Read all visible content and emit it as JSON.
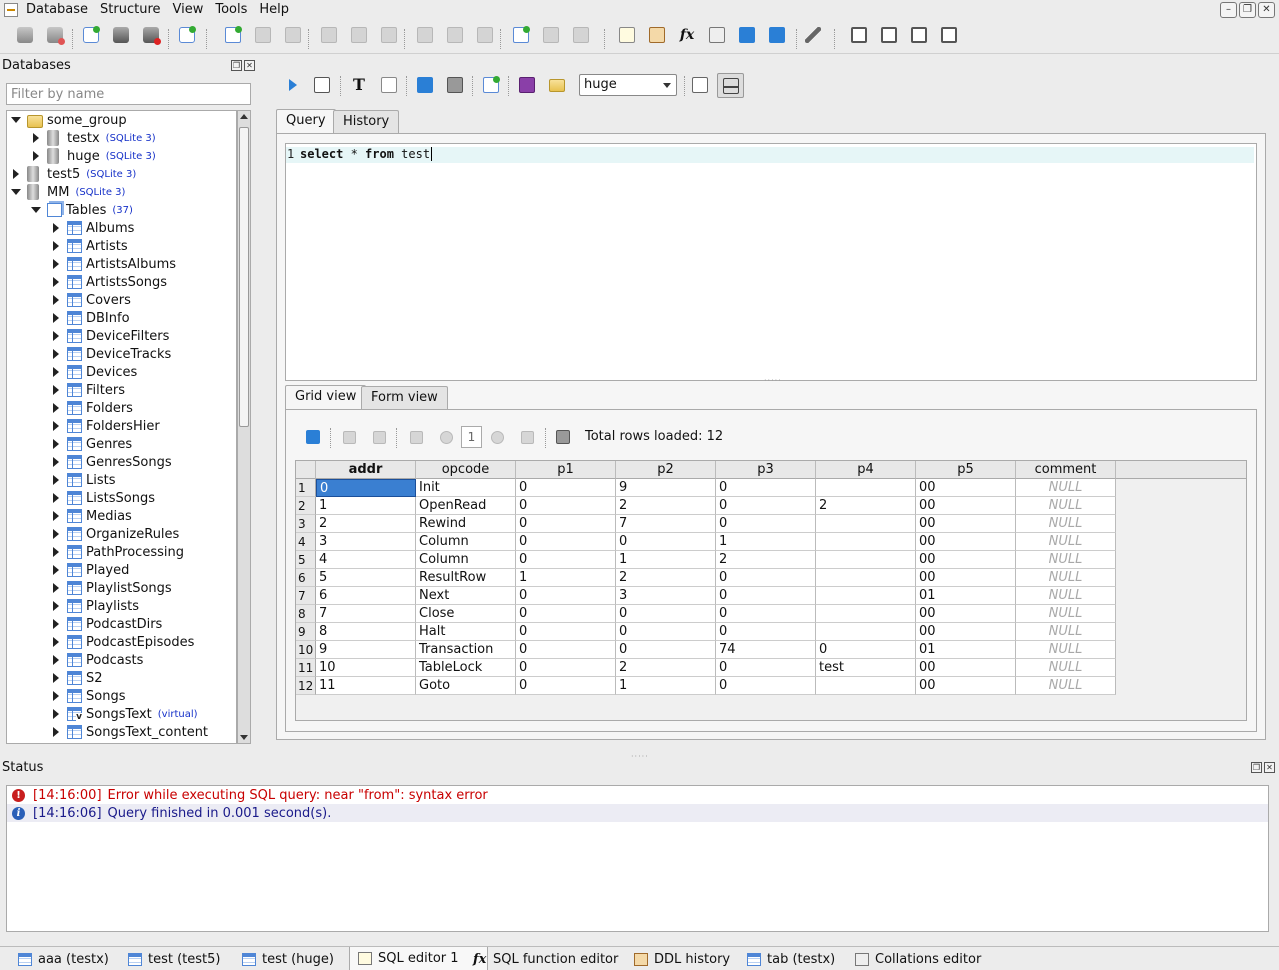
{
  "menu": [
    "Database",
    "Structure",
    "View",
    "Tools",
    "Help"
  ],
  "databases_panel": {
    "title": "Databases",
    "filter_placeholder": "Filter by name",
    "group": "some_group",
    "group_dbs": [
      {
        "name": "testx",
        "type": "(SQLite 3)"
      },
      {
        "name": "huge",
        "type": "(SQLite 3)"
      }
    ],
    "dbs": [
      {
        "name": "test5",
        "type": "(SQLite 3)"
      },
      {
        "name": "MM",
        "type": "(SQLite 3)"
      }
    ],
    "tables_label": "Tables",
    "tables_count": "(37)",
    "tables": [
      "Albums",
      "Artists",
      "ArtistsAlbums",
      "ArtistsSongs",
      "Covers",
      "DBInfo",
      "DeviceFilters",
      "DeviceTracks",
      "Devices",
      "Filters",
      "Folders",
      "FoldersHier",
      "Genres",
      "GenresSongs",
      "Lists",
      "ListsSongs",
      "Medias",
      "OrganizeRules",
      "PathProcessing",
      "Played",
      "PlaylistSongs",
      "Playlists",
      "PodcastDirs",
      "PodcastEpisodes",
      "Podcasts",
      "S2",
      "Songs",
      "SongsText",
      "SongsText_content"
    ],
    "virtual_label": "(virtual)"
  },
  "editor": {
    "db_select": "huge",
    "tabs": [
      "Query",
      "History"
    ],
    "line_number": "1",
    "sql": {
      "kw1": "select",
      "star": " * ",
      "kw2": "from",
      "rest": " test"
    },
    "result_tabs": [
      "Grid view",
      "Form view"
    ],
    "page": "1",
    "rows_loaded": "Total rows loaded: 12"
  },
  "grid": {
    "columns": [
      "addr",
      "opcode",
      "p1",
      "p2",
      "p3",
      "p4",
      "p5",
      "comment"
    ],
    "rows": [
      [
        "0",
        "Init",
        "0",
        "9",
        "0",
        "",
        "00",
        "NULL"
      ],
      [
        "1",
        "OpenRead",
        "0",
        "2",
        "0",
        "2",
        "00",
        "NULL"
      ],
      [
        "2",
        "Rewind",
        "0",
        "7",
        "0",
        "",
        "00",
        "NULL"
      ],
      [
        "3",
        "Column",
        "0",
        "0",
        "1",
        "",
        "00",
        "NULL"
      ],
      [
        "4",
        "Column",
        "0",
        "1",
        "2",
        "",
        "00",
        "NULL"
      ],
      [
        "5",
        "ResultRow",
        "1",
        "2",
        "0",
        "",
        "00",
        "NULL"
      ],
      [
        "6",
        "Next",
        "0",
        "3",
        "0",
        "",
        "01",
        "NULL"
      ],
      [
        "7",
        "Close",
        "0",
        "0",
        "0",
        "",
        "00",
        "NULL"
      ],
      [
        "8",
        "Halt",
        "0",
        "0",
        "0",
        "",
        "00",
        "NULL"
      ],
      [
        "9",
        "Transaction",
        "0",
        "0",
        "74",
        "0",
        "01",
        "NULL"
      ],
      [
        "10",
        "TableLock",
        "0",
        "2",
        "0",
        "test",
        "00",
        "NULL"
      ],
      [
        "11",
        "Goto",
        "0",
        "1",
        "0",
        "",
        "00",
        "NULL"
      ]
    ]
  },
  "status": {
    "title": "Status",
    "messages": [
      {
        "time": "[14:16:00]",
        "text": "Error while executing SQL query: near \"from\": syntax error",
        "level": "error",
        "color": "#c80000"
      },
      {
        "time": "[14:16:06]",
        "text": "Query finished in 0.001 second(s).",
        "level": "info",
        "color": "#1a1a8a"
      }
    ]
  },
  "bottom_tabs": [
    "aaa (testx)",
    "test (test5)",
    "test (huge)",
    "SQL editor 1",
    "SQL function editor",
    "DDL history",
    "tab (testx)",
    "Collations editor"
  ]
}
